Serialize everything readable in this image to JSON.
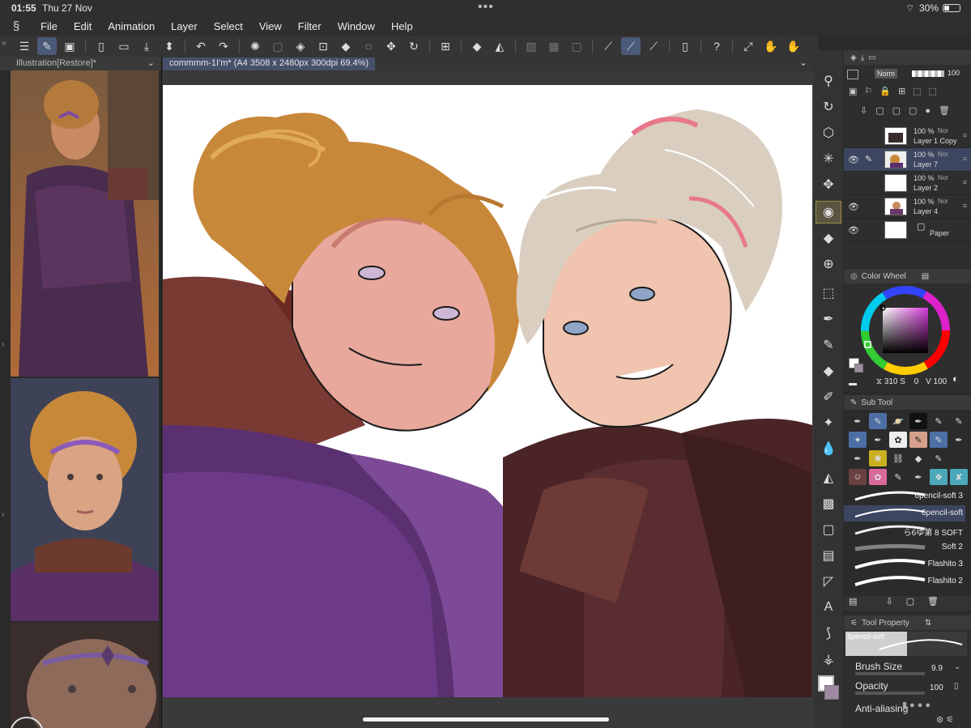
{
  "status": {
    "time": "01:55",
    "date": "Thu 27 Nov",
    "battery": "30%"
  },
  "menu": {
    "items": [
      "File",
      "Edit",
      "Animation",
      "Layer",
      "Select",
      "View",
      "Filter",
      "Window",
      "Help"
    ]
  },
  "reference": {
    "tab": "Illustration[Restore]*"
  },
  "document": {
    "tab": "commmm-1I'm* (A4 3508 x 2480px 300dpi 69.4%)"
  },
  "layerpanel": {
    "blend": "Norm",
    "opacity": "100",
    "layers": [
      {
        "pct": "100 %",
        "mode": "Nor",
        "name": "Layer 1 Copy",
        "visible": false,
        "selected": false
      },
      {
        "pct": "100 %",
        "mode": "Nor",
        "name": "Layer 7",
        "visible": true,
        "selected": true
      },
      {
        "pct": "100 %",
        "mode": "Nor",
        "name": "Layer 2",
        "visible": false,
        "selected": false
      },
      {
        "pct": "100 %",
        "mode": "Nor",
        "name": "Layer 4",
        "visible": true,
        "selected": false
      },
      {
        "pct": "",
        "mode": "",
        "name": "Paper",
        "visible": true,
        "selected": false
      }
    ]
  },
  "colorwheel": {
    "title": "Color Wheel",
    "h": "310",
    "s_label": "S",
    "s": "0",
    "v_label": "V",
    "v": "100"
  },
  "subtool": {
    "title": "Sub Tool",
    "brushes": [
      {
        "name": "6pencil-soft 3",
        "selected": false
      },
      {
        "name": "6pencil-soft",
        "selected": true
      },
      {
        "name": "ら6ゆ第 8 SOFT",
        "selected": false
      },
      {
        "name": "Soft 2",
        "selected": false
      },
      {
        "name": "Flashito 3",
        "selected": false
      },
      {
        "name": "Flashito 2",
        "selected": false
      }
    ]
  },
  "toolprop": {
    "title": "Tool Property",
    "brush_name": "6pencil-soft",
    "size_label": "Brush Size",
    "size_value": "9.9",
    "opacity_label": "Opacity",
    "opacity_value": "100",
    "aa_label": "Anti-aliasing"
  },
  "colors": {
    "accent": "#4d6fa6",
    "selection": "#3c4660",
    "fg": "#ffffff",
    "bg": "#a08aa2"
  }
}
